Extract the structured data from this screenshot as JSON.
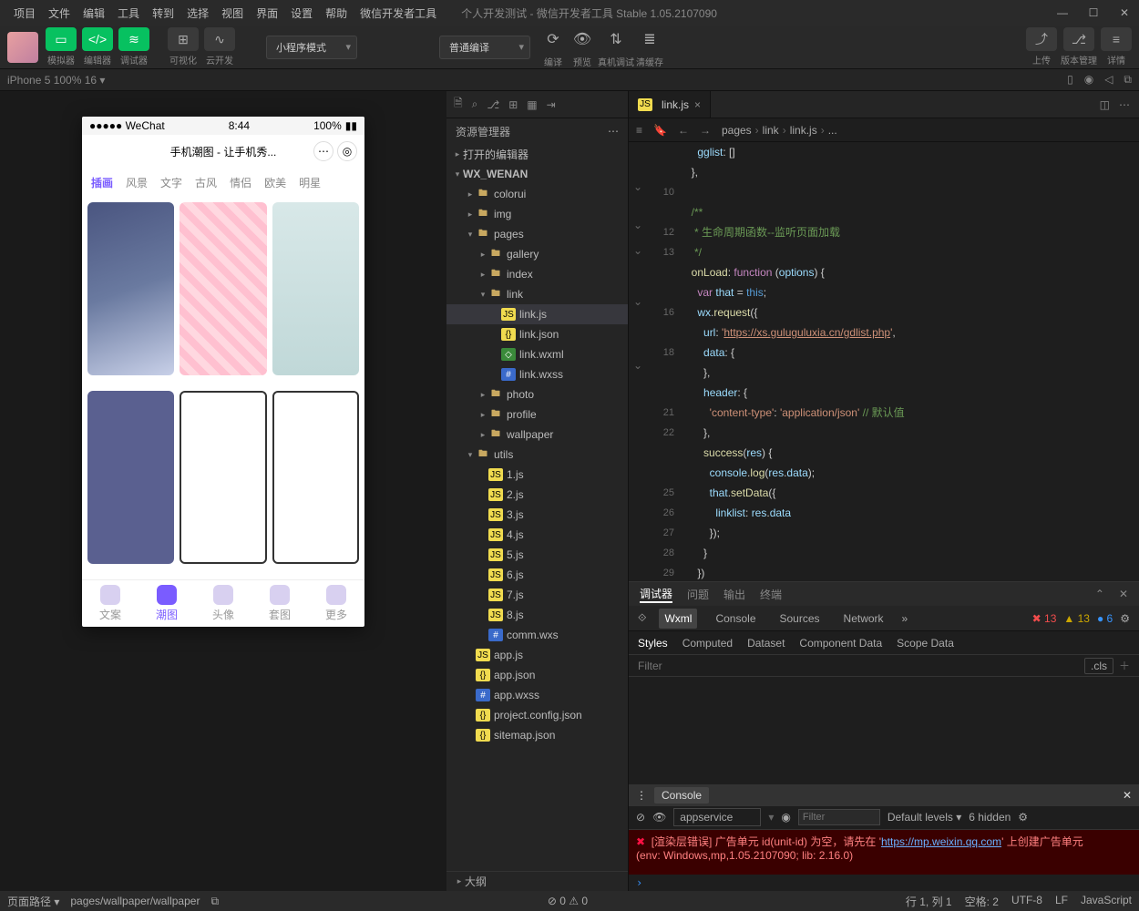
{
  "menu": [
    "项目",
    "文件",
    "编辑",
    "工具",
    "转到",
    "选择",
    "视图",
    "界面",
    "设置",
    "帮助",
    "微信开发者工具"
  ],
  "title": "个人开发测试 - 微信开发者工具 Stable 1.05.2107090",
  "toolbar": {
    "groups": [
      {
        "items": [
          {
            "icon": "▭",
            "label": "模拟器"
          },
          {
            "icon": "</>",
            "label": "编辑器"
          },
          {
            "icon": "≋",
            "label": "调试器"
          }
        ]
      },
      {
        "items": [
          {
            "icon": "⊞",
            "label": "可视化",
            "grey": true
          },
          {
            "icon": "∿",
            "label": "云开发",
            "grey": true
          }
        ]
      }
    ],
    "mode_select": "小程序模式",
    "compile_select": "普通编译",
    "actions": [
      {
        "icon": "⟳",
        "label": "编译"
      },
      {
        "icon": "👁",
        "label": "预览"
      },
      {
        "icon": "⇅",
        "label": "真机调试"
      },
      {
        "icon": "≣",
        "label": "清缓存"
      }
    ],
    "right": [
      {
        "icon": "⤴",
        "label": "上传"
      },
      {
        "icon": "⎇",
        "label": "版本管理"
      },
      {
        "icon": "≡",
        "label": "详情"
      }
    ]
  },
  "secbar": {
    "device": "iPhone 5 100% 16 ▾"
  },
  "phone": {
    "carrier": "●●●●● WeChat",
    "wifi": "📶",
    "time": "8:44",
    "battery": "100%",
    "title": "手机潮图 - 让手机秀...",
    "tabs": [
      "插画",
      "风景",
      "文字",
      "古风",
      "情侣",
      "欧美",
      "明星"
    ],
    "nav": [
      {
        "l": "文案"
      },
      {
        "l": "潮图",
        "active": true
      },
      {
        "l": "头像"
      },
      {
        "l": "套图"
      },
      {
        "l": "更多"
      }
    ]
  },
  "explorer": {
    "title": "资源管理器",
    "sections": [
      {
        "label": "打开的编辑器",
        "depth": 0,
        "arrow": "▸"
      },
      {
        "label": "WX_WENAN",
        "depth": 0,
        "arrow": "▾",
        "bold": true
      },
      {
        "label": "colorui",
        "depth": 1,
        "arrow": "▸",
        "icon": "ffolder"
      },
      {
        "label": "img",
        "depth": 1,
        "arrow": "▸",
        "icon": "ffolder"
      },
      {
        "label": "pages",
        "depth": 1,
        "arrow": "▾",
        "icon": "ffolder"
      },
      {
        "label": "gallery",
        "depth": 2,
        "arrow": "▸",
        "icon": "ffolder"
      },
      {
        "label": "index",
        "depth": 2,
        "arrow": "▸",
        "icon": "ffolder"
      },
      {
        "label": "link",
        "depth": 2,
        "arrow": "▾",
        "icon": "ffolder"
      },
      {
        "label": "link.js",
        "depth": 3,
        "icon": "fjs",
        "selected": true
      },
      {
        "label": "link.json",
        "depth": 3,
        "icon": "fjson"
      },
      {
        "label": "link.wxml",
        "depth": 3,
        "icon": "fwxml"
      },
      {
        "label": "link.wxss",
        "depth": 3,
        "icon": "fwxss"
      },
      {
        "label": "photo",
        "depth": 2,
        "arrow": "▸",
        "icon": "ffolder"
      },
      {
        "label": "profile",
        "depth": 2,
        "arrow": "▸",
        "icon": "ffolder"
      },
      {
        "label": "wallpaper",
        "depth": 2,
        "arrow": "▸",
        "icon": "ffolder"
      },
      {
        "label": "utils",
        "depth": 1,
        "arrow": "▾",
        "icon": "ffolder"
      },
      {
        "label": "1.js",
        "depth": 2,
        "icon": "fjs"
      },
      {
        "label": "2.js",
        "depth": 2,
        "icon": "fjs"
      },
      {
        "label": "3.js",
        "depth": 2,
        "icon": "fjs"
      },
      {
        "label": "4.js",
        "depth": 2,
        "icon": "fjs"
      },
      {
        "label": "5.js",
        "depth": 2,
        "icon": "fjs"
      },
      {
        "label": "6.js",
        "depth": 2,
        "icon": "fjs"
      },
      {
        "label": "7.js",
        "depth": 2,
        "icon": "fjs"
      },
      {
        "label": "8.js",
        "depth": 2,
        "icon": "fjs"
      },
      {
        "label": "comm.wxs",
        "depth": 2,
        "icon": "fwxss"
      },
      {
        "label": "app.js",
        "depth": 1,
        "icon": "fjs"
      },
      {
        "label": "app.json",
        "depth": 1,
        "icon": "fjson"
      },
      {
        "label": "app.wxss",
        "depth": 1,
        "icon": "fwxss"
      },
      {
        "label": "project.config.json",
        "depth": 1,
        "icon": "fjson"
      },
      {
        "label": "sitemap.json",
        "depth": 1,
        "icon": "fjson"
      }
    ],
    "outline": "大纲"
  },
  "editor": {
    "tab": {
      "icon": "JS",
      "name": "link.js"
    },
    "breadcrumb": [
      "pages",
      "link",
      "link.js",
      "..."
    ],
    "lines": [
      {
        "n": "",
        "html": "    <span class='prop'>gglist</span>: []"
      },
      {
        "n": "",
        "html": "  },"
      },
      {
        "n": "10",
        "html": ""
      },
      {
        "n": "",
        "html": "  <span class='com'>/**</span>"
      },
      {
        "n": "12",
        "html": "  <span class='com'> * 生命周期函数--监听页面加载</span>"
      },
      {
        "n": "13",
        "html": "  <span class='com'> */</span>"
      },
      {
        "n": "",
        "html": "  <span class='fn'>onLoad</span>: <span class='kw'>function</span> (<span class='prop'>options</span>) {"
      },
      {
        "n": "",
        "html": "    <span class='kw'>var</span> <span class='prop'>that</span> = <span class='this'>this</span>;"
      },
      {
        "n": "16",
        "html": "    <span class='prop'>wx</span>.<span class='fn'>request</span>({"
      },
      {
        "n": "",
        "html": "      <span class='prop'>url</span>: <span class='str'>'<span class='url'>https://xs.guluguluxia.cn/gdlist.php</span>'</span>,"
      },
      {
        "n": "18",
        "html": "      <span class='prop'>data</span>: {"
      },
      {
        "n": "",
        "html": "      },"
      },
      {
        "n": "",
        "html": "      <span class='prop'>header</span>: {"
      },
      {
        "n": "21",
        "html": "        <span class='str'>'content-type'</span>: <span class='str'>'application/json'</span> <span class='com'>// 默认值</span>"
      },
      {
        "n": "22",
        "html": "      },"
      },
      {
        "n": "",
        "html": "      <span class='fn'>success</span>(<span class='prop'>res</span>) {"
      },
      {
        "n": "",
        "html": "        <span class='prop'>console</span>.<span class='fn'>log</span>(<span class='prop'>res</span>.<span class='prop'>data</span>);"
      },
      {
        "n": "25",
        "html": "        <span class='prop'>that</span>.<span class='fn'>setData</span>({"
      },
      {
        "n": "26",
        "html": "          <span class='prop'>linklist</span>: <span class='prop'>res</span>.<span class='prop'>data</span>"
      },
      {
        "n": "27",
        "html": "        });"
      },
      {
        "n": "28",
        "html": "      }"
      },
      {
        "n": "29",
        "html": "    })"
      }
    ]
  },
  "debugger": {
    "top_tabs": [
      "调试器",
      "问题",
      "输出",
      "终端"
    ],
    "tools": [
      "Wxml",
      "Console",
      "Sources",
      "Network"
    ],
    "badges": {
      "err": "13",
      "warn": "13",
      "info": "6"
    },
    "styles_tabs": [
      "Styles",
      "Computed",
      "Dataset",
      "Component Data",
      "Scope Data"
    ],
    "filter_placeholder": "Filter",
    "cls": ".cls",
    "console_title": "Console",
    "context": "appservice",
    "levels": "Default levels ▾",
    "hidden": "6 hidden",
    "error_line1": "[渲染层错误] 广告单元 id(unit-id) 为空，请先在 '",
    "error_link": "https://mp.weixin.qq.com",
    "error_line1b": "' 上创建广告单元",
    "error_line2": "(env: Windows,mp,1.05.2107090; lib: 2.16.0)"
  },
  "status": {
    "left_label": "页面路径 ▾",
    "path": "pages/wallpaper/wallpaper",
    "counters": "⊘ 0 ⚠ 0",
    "right": [
      "行 1, 列 1",
      "空格: 2",
      "UTF-8",
      "LF",
      "JavaScript"
    ]
  }
}
